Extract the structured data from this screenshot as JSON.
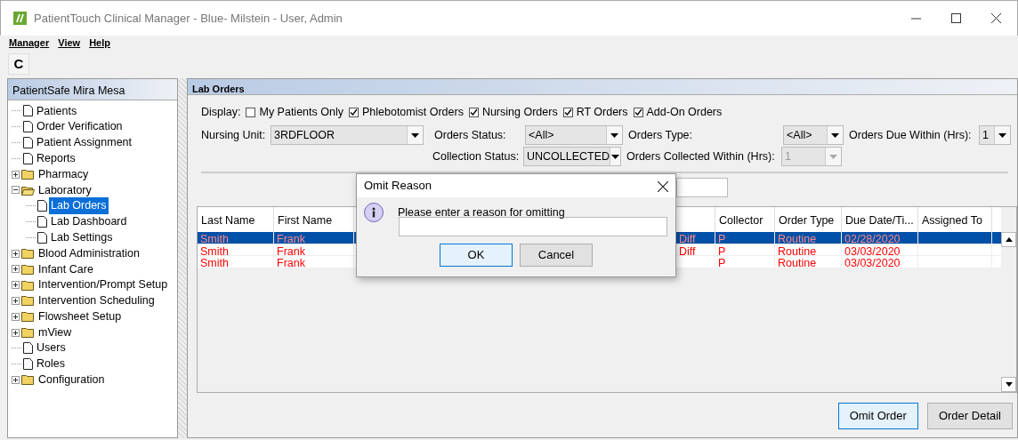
{
  "window": {
    "title": "PatientTouch Clinical Manager - Blue- Milstein - User, Admin"
  },
  "menu": [
    "Manager",
    "View",
    "Help"
  ],
  "toolbar": {
    "refresh_button": "C"
  },
  "sidebar": {
    "title": "PatientSafe Mira Mesa",
    "items": [
      {
        "label": "Patients",
        "kind": "page",
        "selected": false
      },
      {
        "label": "Order Verification",
        "kind": "page",
        "selected": false
      },
      {
        "label": "Patient Assignment",
        "kind": "page",
        "selected": false
      },
      {
        "label": "Reports",
        "kind": "page",
        "selected": false
      },
      {
        "label": "Pharmacy",
        "kind": "folder",
        "expanded": false,
        "selected": false
      },
      {
        "label": "Laboratory",
        "kind": "folder",
        "expanded": true,
        "selected": false,
        "children": [
          {
            "label": "Lab Orders",
            "kind": "page",
            "selected": true
          },
          {
            "label": "Lab Dashboard",
            "kind": "page",
            "selected": false
          },
          {
            "label": "Lab Settings",
            "kind": "page",
            "selected": false
          }
        ]
      },
      {
        "label": "Blood Administration",
        "kind": "folder",
        "expanded": false,
        "selected": false
      },
      {
        "label": "Infant Care",
        "kind": "folder",
        "expanded": false,
        "selected": false
      },
      {
        "label": "Intervention/Prompt Setup",
        "kind": "folder",
        "expanded": false,
        "selected": false
      },
      {
        "label": "Intervention Scheduling",
        "kind": "folder",
        "expanded": false,
        "selected": false
      },
      {
        "label": "Flowsheet Setup",
        "kind": "folder",
        "expanded": false,
        "selected": false
      },
      {
        "label": "mView",
        "kind": "folder",
        "expanded": false,
        "selected": false
      },
      {
        "label": "Users",
        "kind": "page",
        "selected": false
      },
      {
        "label": "Roles",
        "kind": "page",
        "selected": false
      },
      {
        "label": "Configuration",
        "kind": "folder",
        "expanded": false,
        "selected": false
      }
    ]
  },
  "panel": {
    "title": "Lab Orders",
    "display": {
      "label": "Display:",
      "options": [
        {
          "label": "My Patients Only",
          "checked": false
        },
        {
          "label": "Phlebotomist Orders",
          "checked": true
        },
        {
          "label": "Nursing Orders",
          "checked": true
        },
        {
          "label": "RT Orders",
          "checked": true
        },
        {
          "label": "Add-On Orders",
          "checked": true
        }
      ]
    },
    "filters": [
      {
        "label": "Nursing Unit:",
        "value": "3RDFLOOR",
        "disabled": false
      },
      {
        "label": "Orders Status:",
        "value": "<All>",
        "disabled": false
      },
      {
        "label": "Orders Type:",
        "value": "<All>",
        "disabled": false
      },
      {
        "label": "Orders Due Within (Hrs):",
        "value": "1",
        "disabled": false
      },
      {
        "label": "Collection Status:",
        "value": "UNCOLLECTED",
        "disabled": false
      },
      {
        "label": "Orders Collected Within (Hrs):",
        "value": "1",
        "disabled": true
      }
    ],
    "table": {
      "columns": {
        "last_name": "Last Name",
        "first_name": "First Name",
        "collector": "Collector",
        "order_type": "Order Type",
        "due_date": "Due Date/Ti...",
        "assigned_to": "Assigned To"
      },
      "rows": [
        {
          "selected": true,
          "last_name": "Smith",
          "first_name": "Frank",
          "column_3": "Diff",
          "collector": "P",
          "order_type": "Routine",
          "due_date": "02/28/2020"
        },
        {
          "selected": false,
          "last_name": "Smith",
          "first_name": "Frank",
          "column_3": "Diff",
          "collector": "P",
          "order_type": "Routine",
          "due_date": "03/03/2020"
        },
        {
          "selected": false,
          "last_name": "Smith",
          "first_name": "Frank",
          "collector": "P",
          "order_type": "Routine",
          "due_date": "03/03/2020"
        }
      ]
    },
    "buttons": [
      {
        "label": "Omit Order",
        "focused": true
      },
      {
        "label": "Order Detail",
        "focused": false
      }
    ]
  },
  "dialog": {
    "title": "Omit Reason",
    "message": "Please enter a reason for omitting",
    "buttons": [
      {
        "label": "OK",
        "focused": true
      },
      {
        "label": "Cancel",
        "focused": false
      }
    ]
  }
}
